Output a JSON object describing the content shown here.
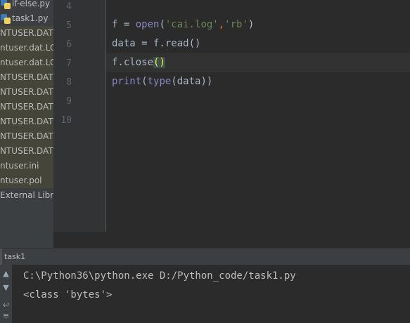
{
  "project_tree": {
    "items": [
      {
        "label": "if-else.py",
        "kind": "python-file",
        "icon": "python-file-icon"
      },
      {
        "label": "task1.py",
        "kind": "python-file",
        "icon": "python-file-icon"
      },
      {
        "label": "NTUSER.DAT",
        "kind": "file"
      },
      {
        "label": "ntuser.dat.LO",
        "kind": "file"
      },
      {
        "label": "ntuser.dat.LO",
        "kind": "file"
      },
      {
        "label": "NTUSER.DAT{",
        "kind": "file"
      },
      {
        "label": "NTUSER.DAT{",
        "kind": "file"
      },
      {
        "label": "NTUSER.DAT{",
        "kind": "file"
      },
      {
        "label": "NTUSER.DAT{",
        "kind": "file"
      },
      {
        "label": "NTUSER.DAT{",
        "kind": "file"
      },
      {
        "label": "NTUSER.DAT{",
        "kind": "file"
      },
      {
        "label": "ntuser.ini",
        "kind": "file"
      },
      {
        "label": "ntuser.pol",
        "kind": "file"
      },
      {
        "label": "External Libra",
        "kind": "library"
      }
    ]
  },
  "editor": {
    "line_numbers": [
      "4",
      "5",
      "6",
      "7",
      "8",
      "9",
      "10"
    ],
    "lines": {
      "l5": {
        "var": "f = ",
        "func": "open",
        "open_paren": "(",
        "arg1": "'cai.log'",
        "comma": ",",
        "arg2": "'rb'",
        "close_paren": ")"
      },
      "l6": {
        "text": "data = f.read()"
      },
      "l7": {
        "prefix": "f.close",
        "match_brackets": "()"
      },
      "l8": {
        "func1": "print",
        "p1": "(",
        "func2": "type",
        "rest": "(data))"
      }
    },
    "current_line": "7"
  },
  "run_panel": {
    "title": "task1",
    "console_lines": [
      "C:\\Python36\\python.exe D:/Python_code/task1.py",
      "<class 'bytes'>"
    ]
  },
  "colors": {
    "background": "#2b2b2b",
    "sidebar": "#3c3f41",
    "builtin": "#8888c6",
    "string": "#6a8759",
    "keyword_comma": "#cc7832",
    "brace_match": "#ffef28"
  }
}
